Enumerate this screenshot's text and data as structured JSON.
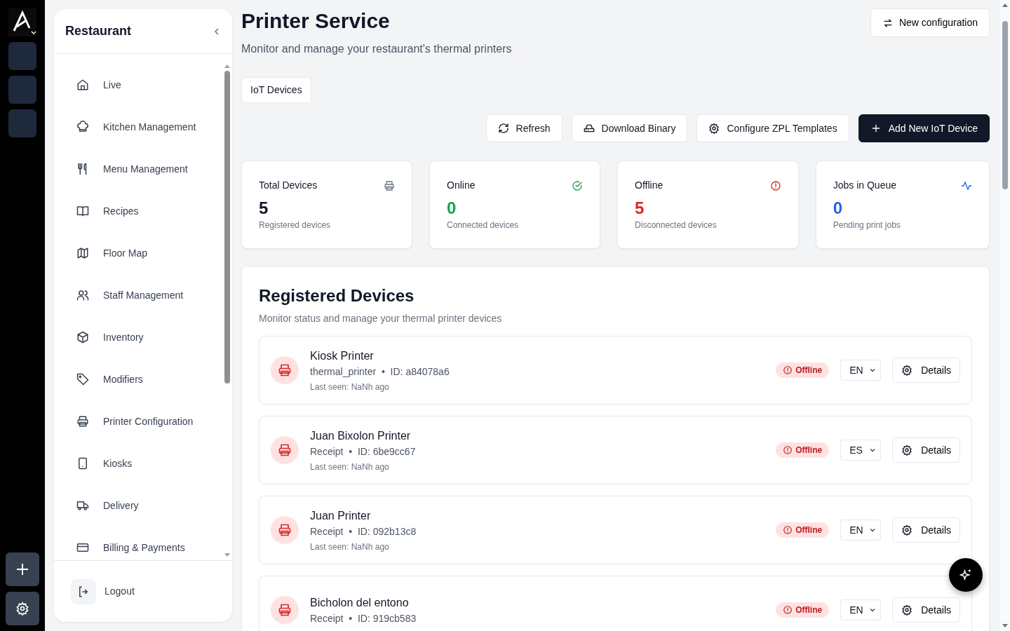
{
  "sidebar": {
    "title": "Restaurant",
    "items": [
      {
        "label": "Live"
      },
      {
        "label": "Kitchen Management"
      },
      {
        "label": "Menu Management"
      },
      {
        "label": "Recipes"
      },
      {
        "label": "Floor Map"
      },
      {
        "label": "Staff Management"
      },
      {
        "label": "Inventory"
      },
      {
        "label": "Modifiers"
      },
      {
        "label": "Printer Configuration"
      },
      {
        "label": "Kiosks"
      },
      {
        "label": "Delivery"
      },
      {
        "label": "Billing & Payments"
      }
    ],
    "logout": "Logout"
  },
  "header": {
    "title": "Printer Service",
    "subtitle": "Monitor and manage your restaurant's thermal printers",
    "new_config": "New configuration"
  },
  "tabs": [
    {
      "label": "IoT Devices",
      "selected": true
    }
  ],
  "actions": [
    {
      "label": "Refresh",
      "kind": "refresh"
    },
    {
      "label": "Download Binary",
      "kind": "download"
    },
    {
      "label": "Configure ZPL Templates",
      "kind": "settings"
    },
    {
      "label": "Add New IoT Device",
      "kind": "add"
    }
  ],
  "stats": [
    {
      "title": "Total Devices",
      "value": "5",
      "caption": "Registered devices",
      "color": "#111827",
      "kind": "printer"
    },
    {
      "title": "Online",
      "value": "0",
      "caption": "Connected devices",
      "color": "#16a34a",
      "kind": "check"
    },
    {
      "title": "Offline",
      "value": "5",
      "caption": "Disconnected devices",
      "color": "#dc2626",
      "kind": "alert"
    },
    {
      "title": "Jobs in Queue",
      "value": "0",
      "caption": "Pending print jobs",
      "color": "#2563eb",
      "kind": "activity"
    }
  ],
  "devices_panel": {
    "title": "Registered Devices",
    "subtitle": "Monitor status and manage your thermal printer devices",
    "devices": [
      {
        "name": "Kiosk Printer",
        "type": "thermal_printer",
        "separator": "•",
        "id": "ID: a84078a6",
        "last_seen": "Last seen: NaNh ago",
        "status": "Offline",
        "online": false,
        "language": "EN",
        "details": "Details"
      },
      {
        "name": "Juan Bixolon Printer",
        "type": "Receipt",
        "separator": "•",
        "id": "ID: 6be9cc67",
        "last_seen": "Last seen: NaNh ago",
        "status": "Offline",
        "online": false,
        "language": "ES",
        "details": "Details"
      },
      {
        "name": "Juan Printer",
        "type": "Receipt",
        "separator": "•",
        "id": "ID: 092b13c8",
        "last_seen": "Last seen: NaNh ago",
        "status": "Offline",
        "online": false,
        "language": "EN",
        "details": "Details"
      },
      {
        "name": "Bicholon del entono",
        "type": "Receipt",
        "separator": "•",
        "id": "ID: 919cb583",
        "status": "Offline",
        "online": false,
        "language": "EN",
        "details": "Details"
      }
    ]
  }
}
